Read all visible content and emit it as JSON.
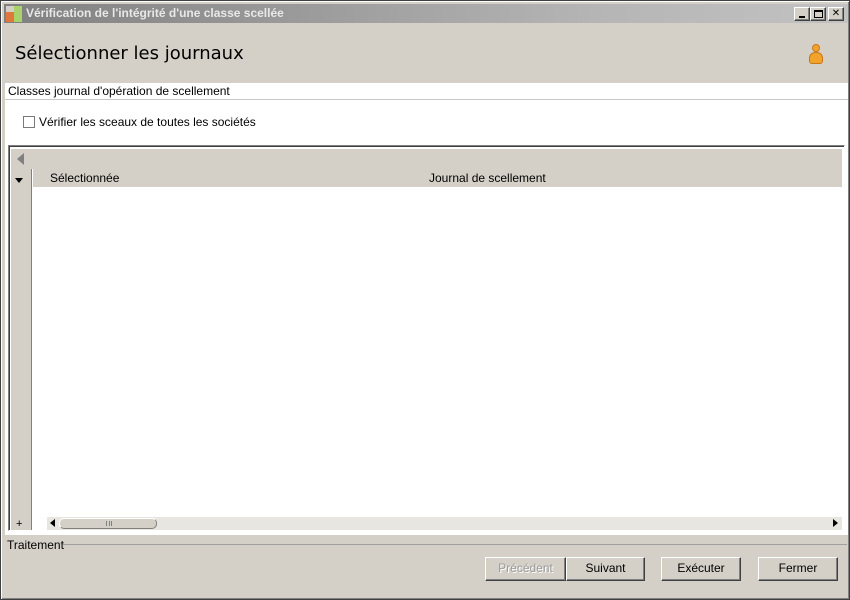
{
  "window": {
    "title": "Vérification de l'intégrité d'une classe scellée"
  },
  "header": {
    "title": "Sélectionner les journaux",
    "icon": "user-icon"
  },
  "section": {
    "label": "Classes journal d'opération de scellement"
  },
  "checkbox": {
    "label": "Vérifier les sceaux de toutes les sociétés",
    "checked": false
  },
  "grid": {
    "columns": [
      "Sélectionnée",
      "Journal de scellement"
    ],
    "rows": [],
    "add_row_label": "+"
  },
  "footer": {
    "status_label": "Traitement",
    "buttons": {
      "previous": "Précédent",
      "next": "Suivant",
      "execute": "Exécuter",
      "close": "Fermer"
    }
  },
  "colors": {
    "window_bg": "#d4d0c8",
    "content_bg": "#ffffff",
    "title_gradient_start": "#808080",
    "user_icon": "#f2a329"
  }
}
